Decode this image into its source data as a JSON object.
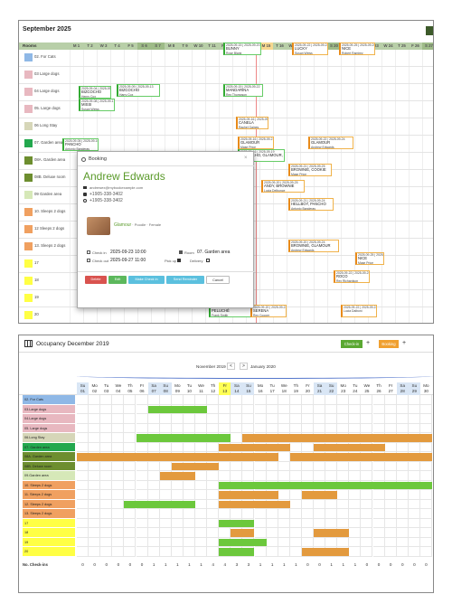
{
  "top": {
    "title": "September 2025",
    "rooms_header": "Rooms",
    "days": [
      "M 1",
      "T 2",
      "W 3",
      "T 4",
      "F 5",
      "S 6",
      "S 7",
      "M 8",
      "T 9",
      "W 10",
      "T 11",
      "F 12",
      "S 13",
      "S 14",
      "M 15",
      "T 16",
      "W 17",
      "T 18",
      "F 19",
      "S 20",
      "S 21",
      "M 22",
      "T 23",
      "W 24",
      "T 25",
      "F 26",
      "S 27"
    ],
    "rooms": [
      {
        "name": "02. For Cats",
        "color": "#8fb8e6"
      },
      {
        "name": "03 Large dogs",
        "color": "#e8b8c0"
      },
      {
        "name": "04 Large dogs",
        "color": "#e8b8c0"
      },
      {
        "name": "05. Large dogs",
        "color": "#e8b8c0"
      },
      {
        "name": "06 Long Stay",
        "color": "#d6d6b8"
      },
      {
        "name": "07. Garden area",
        "color": "#23a84e"
      },
      {
        "name": "08A. Garden area",
        "color": "#6d8e2f"
      },
      {
        "name": "08B. Deluxe room",
        "color": "#6d8e2f"
      },
      {
        "name": "09 Garden area",
        "color": "#d6e8b8"
      },
      {
        "name": "10. Sleeps 2 dogs",
        "color": "#f0a060"
      },
      {
        "name": "12 Sleeps 2 dogs",
        "color": "#f0a060"
      },
      {
        "name": "13. Sleeps 2 dogs",
        "color": "#f0a060"
      },
      {
        "name": "17",
        "color": "#ffff44"
      },
      {
        "name": "18",
        "color": "#ffff44"
      },
      {
        "name": "19",
        "color": "#ffff44"
      },
      {
        "name": "20",
        "color": "#ffff44"
      }
    ],
    "bookings": [
      {
        "d": "2025-09-15 | 2025-09-20",
        "n": "BUNNY",
        "o": "Rose Blank",
        "c": "g"
      },
      {
        "d": "2025-09-22 | 2025-09-24",
        "n": "LUCKY",
        "o": "Susan Weiss",
        "c": "o"
      },
      {
        "d": "2025-09-25 | 2025-09-26",
        "n": "NICE",
        "o": "Robert Ramirez",
        "c": "o"
      },
      {
        "d": "2025-09-09 | 2025-09-13",
        "n": "BIZCOCHO",
        "o": "Harry Cox",
        "c": "g"
      },
      {
        "d": "2025-09-15 | 2025-09-22",
        "n": "MANDARINA",
        "o": "Rex Thompson",
        "c": "g"
      },
      {
        "d": "2025-09-04 | 2025-09-08",
        "n": "BIZCOCHO",
        "o": "Henry Cox",
        "c": "g"
      },
      {
        "d": "2025-09-08 | 2025-09-17",
        "n": "MISSI",
        "o": "Susan Weiss",
        "c": "g"
      },
      {
        "d": "2025-09-16 | 2025-09-18",
        "n": "CANELA",
        "o": "Rachel Gaines",
        "c": "o"
      },
      {
        "d": "2025-09-05 | 2025-09-10",
        "n": "PANCHO",
        "o": "Antonio Banderas",
        "c": "g"
      },
      {
        "d": "2025-09-16 | 2025-09-21",
        "n": "GLAMOUR",
        "o": "Mase Price",
        "c": "o"
      },
      {
        "d": "2025-09-22 | 2025-09-24",
        "n": "GLAMOUR",
        "o": "Andrew Edwards",
        "c": "o"
      },
      {
        "d": "2025-09-16 | 2025-09-19",
        "n": "BIZCOCHO, GLAMOUR, HELLBOY",
        "o": "Harry Cox",
        "c": "g"
      },
      {
        "d": "2025-09-21 | 2025-09-25",
        "n": "BROWNIE, COOKIE",
        "o": "Mase Price",
        "c": "o"
      },
      {
        "d": "2025-09-20 | 2025-09-25",
        "n": "ANDY, BROWNIE",
        "o": "Lucia Delbonce",
        "c": "o"
      },
      {
        "d": "2025-09-21 | 2025-09-24",
        "n": "HELLBOY, PANCHO",
        "o": "Antonio Banderas",
        "c": "o"
      },
      {
        "d": "2025-09-16 | 2025-09-18",
        "n": "BROWNIE, COOKIE",
        "o": "Frank Burke",
        "c": "g"
      },
      {
        "d": "2025-09-15 | 2025-09-17",
        "n": "BROWNIE, PANCHO",
        "o": "Mase Price",
        "c": "g"
      },
      {
        "d": "2025-09-20 | 2025-09-24",
        "n": "BROWNIE, GLAMOUR",
        "o": "Andrew Edwards",
        "c": "o"
      },
      {
        "d": "2025-09-15 | 2025-09-18",
        "n": "PELUCHE",
        "o": "Peter Cooper",
        "c": "g"
      },
      {
        "d": "2025-09-25 | 2025-09-26",
        "n": "NICE",
        "o": "Mase Price",
        "c": "o"
      },
      {
        "d": "2025-09-15 | 2025-09-17",
        "n": "HELLBOY",
        "o": "Patrick Smith",
        "c": "g"
      },
      {
        "d": "2025-09-22 | 2025-09-25",
        "n": "ROCO",
        "o": "Rex Richardson",
        "c": "o"
      },
      {
        "d": "2025-09-12 | 2025-09-15",
        "n": "GLAMOUR",
        "o": "Patrick Smith",
        "c": "g"
      },
      {
        "d": "2025-09-16 | 2025-09-18",
        "n": "PELUCHE",
        "o": "Frank Smith",
        "c": "g"
      },
      {
        "d": "2025-09-20 | 2025-09-22",
        "n": "SERENA",
        "o": "Rex Cooper",
        "c": "o"
      },
      {
        "d": "2025-09-22 | 2025-09-24",
        "n": "",
        "o": "Lucia Dalboni",
        "c": "o"
      }
    ],
    "modal": {
      "title": "Booking",
      "close": "×",
      "name": "Andrew Edwards",
      "email": "andrewex@mybookexample.com",
      "phone1": "+1905-338-3402",
      "phone2": "+1905-338-3402",
      "pet": "Glamour",
      "pet_info": " · Poodle · Female",
      "checkin_label": "Check in",
      "checkin": "2025-09-23 10:00",
      "checkout_label": "Check out",
      "checkout": "2025-09-27 11:00",
      "room_label": "Room",
      "room": "07. Garden area",
      "pickup": "Pick up",
      "delivery": "Delivery",
      "buttons": [
        "Delete",
        "Edit",
        "Make Check in",
        "Send Reminder",
        "Cancel"
      ]
    }
  },
  "bottom": {
    "title": "Occupancy December 2019",
    "checkin": "Check-in",
    "booking": "Booking",
    "plus": "+",
    "prev_month": "November 2019",
    "prev": "<",
    "next": ">",
    "next_month": "January 2020",
    "weekdays": [
      "Su",
      "Mo",
      "Tu",
      "We",
      "Th",
      "Fr",
      "Sa",
      "Su",
      "Mo",
      "Tu",
      "We",
      "Th",
      "Fr",
      "Sa",
      "Su",
      "Mo",
      "Tu",
      "We",
      "Th",
      "Fr",
      "Sa",
      "Su",
      "Mo",
      "Tu",
      "We",
      "Th",
      "Fr",
      "Sa",
      "Su",
      "Mo"
    ],
    "dates": [
      "01",
      "02",
      "03",
      "04",
      "05",
      "06",
      "07",
      "08",
      "09",
      "10",
      "11",
      "12",
      "13",
      "14",
      "15",
      "16",
      "17",
      "18",
      "19",
      "20",
      "21",
      "22",
      "23",
      "24",
      "25",
      "26",
      "27",
      "28",
      "29",
      "30"
    ],
    "rooms": [
      {
        "name": "02. For Cats",
        "color": "#8fb8e6"
      },
      {
        "name": "03.Large dogs",
        "color": "#e8b8c0"
      },
      {
        "name": "04.Large dogs",
        "color": "#e8b8c0"
      },
      {
        "name": "05. Large dogs",
        "color": "#e8b8c0"
      },
      {
        "name": "06.Long Stay",
        "color": "#d6d6b8"
      },
      {
        "name": "07. Garden area",
        "color": "#23a84e"
      },
      {
        "name": "08A. Garden area",
        "color": "#6d8e2f"
      },
      {
        "name": "08B. Deluxe room",
        "color": "#6d8e2f"
      },
      {
        "name": "09.Garden area",
        "color": "#d6e8b8"
      },
      {
        "name": "10. Sleeps 2 dogs",
        "color": "#f0a060"
      },
      {
        "name": "11. Sleeps 2 dogs",
        "color": "#f0a060"
      },
      {
        "name": "12. Sleeps 2 dogs",
        "color": "#f0a060"
      },
      {
        "name": "13. Sleeps 2 dogs",
        "color": "#f0a060"
      },
      {
        "name": "17",
        "color": "#ffff44"
      },
      {
        "name": "18",
        "color": "#ffff44"
      },
      {
        "name": "19",
        "color": "#ffff44"
      },
      {
        "name": "20",
        "color": "#ffff44"
      }
    ],
    "bars": [
      {
        "row": 1,
        "s": 6,
        "e": 11,
        "c": "g"
      },
      {
        "row": 4,
        "s": 5,
        "e": 13,
        "c": "g"
      },
      {
        "row": 4,
        "s": 14,
        "e": 30,
        "c": "o"
      },
      {
        "row": 5,
        "s": 12,
        "e": 18,
        "c": "o"
      },
      {
        "row": 5,
        "s": 20,
        "e": 26,
        "c": "o"
      },
      {
        "row": 6,
        "s": 0,
        "e": 17,
        "c": "o"
      },
      {
        "row": 6,
        "s": 18,
        "e": 30,
        "c": "o"
      },
      {
        "row": 7,
        "s": 8,
        "e": 12,
        "c": "o"
      },
      {
        "row": 8,
        "s": 7,
        "e": 10,
        "c": "o"
      },
      {
        "row": 9,
        "s": 12,
        "e": 30,
        "c": "g"
      },
      {
        "row": 10,
        "s": 12,
        "e": 17,
        "c": "o"
      },
      {
        "row": 10,
        "s": 19,
        "e": 22,
        "c": "o"
      },
      {
        "row": 11,
        "s": 4,
        "e": 10,
        "c": "g"
      },
      {
        "row": 11,
        "s": 12,
        "e": 18,
        "c": "o"
      },
      {
        "row": 13,
        "s": 12,
        "e": 15,
        "c": "g"
      },
      {
        "row": 14,
        "s": 13,
        "e": 15,
        "c": "o"
      },
      {
        "row": 14,
        "s": 20,
        "e": 23,
        "c": "o"
      },
      {
        "row": 15,
        "s": 12,
        "e": 16,
        "c": "g"
      },
      {
        "row": 16,
        "s": 12,
        "e": 15,
        "c": "g"
      },
      {
        "row": 16,
        "s": 19,
        "e": 23,
        "c": "o"
      }
    ],
    "footer_label": "No. Check-ins",
    "checkins": [
      "0",
      "0",
      "0",
      "0",
      "0",
      "0",
      "1",
      "1",
      "1",
      "1",
      "1",
      "4",
      "4",
      "3",
      "3",
      "1",
      "1",
      "1",
      "1",
      "0",
      "0",
      "1",
      "1",
      "1",
      "0",
      "0",
      "0",
      "0",
      "0",
      "0"
    ]
  }
}
